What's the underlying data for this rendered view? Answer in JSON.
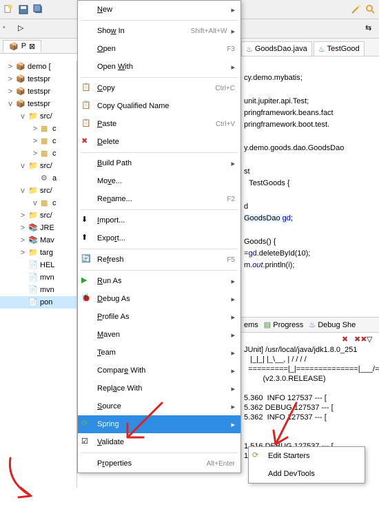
{
  "toolbar_top": {
    "items": [
      "new",
      "save",
      "open",
      "print"
    ]
  },
  "tabs_left": {
    "p": "P"
  },
  "editor_tabs": [
    {
      "icon": "java",
      "label": "GoodsDao.java"
    },
    {
      "icon": "java",
      "label": "TestGood"
    }
  ],
  "tree": [
    {
      "l": 1,
      "exp": ">",
      "icon": "pkg",
      "label": "demo ["
    },
    {
      "l": 1,
      "exp": ">",
      "icon": "pkg",
      "label": "testspr"
    },
    {
      "l": 1,
      "exp": ">",
      "icon": "pkg",
      "label": "testspr"
    },
    {
      "l": 1,
      "exp": "v",
      "icon": "pkg",
      "label": "testspr"
    },
    {
      "l": 2,
      "exp": "v",
      "icon": "srcfolder",
      "label": "src/"
    },
    {
      "l": 3,
      "exp": ">",
      "icon": "package",
      "label": "c"
    },
    {
      "l": 3,
      "exp": ">",
      "icon": "package",
      "label": "c"
    },
    {
      "l": 3,
      "exp": ">",
      "icon": "package",
      "label": "c"
    },
    {
      "l": 2,
      "exp": "v",
      "icon": "srcfolder",
      "label": "src/"
    },
    {
      "l": 3,
      "exp": "",
      "icon": "app",
      "label": "a"
    },
    {
      "l": 2,
      "exp": "v",
      "icon": "srcfolder",
      "label": "src/"
    },
    {
      "l": 3,
      "exp": "v",
      "icon": "package",
      "label": "c"
    },
    {
      "l": 2,
      "exp": ">",
      "icon": "srcfolder",
      "label": "src/"
    },
    {
      "l": 2,
      "exp": ">",
      "icon": "lib",
      "label": "JRE"
    },
    {
      "l": 2,
      "exp": ">",
      "icon": "lib",
      "label": "Mav"
    },
    {
      "l": 2,
      "exp": ">",
      "icon": "folder",
      "label": "targ"
    },
    {
      "l": 2,
      "exp": "",
      "icon": "file",
      "label": "HEL"
    },
    {
      "l": 2,
      "exp": "",
      "icon": "file",
      "label": "mvn"
    },
    {
      "l": 2,
      "exp": "",
      "icon": "file",
      "label": "mvn"
    },
    {
      "l": 2,
      "exp": "",
      "icon": "xml",
      "label": "pon",
      "sel": true
    }
  ],
  "ctx": [
    {
      "t": "mi",
      "icon": "",
      "label": "New",
      "sc": "",
      "sub": true,
      "u": 0
    },
    {
      "t": "sep"
    },
    {
      "t": "mi",
      "icon": "",
      "label": "Show In",
      "sc": "Shift+Alt+W",
      "sub": true,
      "u": 3
    },
    {
      "t": "mi",
      "icon": "",
      "label": "Open",
      "sc": "F3",
      "u": 0
    },
    {
      "t": "mi",
      "icon": "",
      "label": "Open With",
      "sc": "",
      "sub": true,
      "u": 5
    },
    {
      "t": "sep"
    },
    {
      "t": "mi",
      "icon": "copy",
      "label": "Copy",
      "sc": "Ctrl+C",
      "u": 0
    },
    {
      "t": "mi",
      "icon": "copyq",
      "label": "Copy Qualified Name",
      "sc": ""
    },
    {
      "t": "mi",
      "icon": "paste",
      "label": "Paste",
      "sc": "Ctrl+V",
      "u": 0
    },
    {
      "t": "mi",
      "icon": "delete",
      "label": "Delete",
      "sc": "",
      "u": 0
    },
    {
      "t": "sep"
    },
    {
      "t": "mi",
      "icon": "",
      "label": "Build Path",
      "sc": "",
      "sub": true,
      "u": 0
    },
    {
      "t": "mi",
      "icon": "",
      "label": "Move...",
      "sc": "",
      "u": 2
    },
    {
      "t": "mi",
      "icon": "",
      "label": "Rename...",
      "sc": "F2",
      "u": 2
    },
    {
      "t": "sep"
    },
    {
      "t": "mi",
      "icon": "import",
      "label": "Import...",
      "sc": "",
      "u": 0
    },
    {
      "t": "mi",
      "icon": "export",
      "label": "Export...",
      "sc": "",
      "u": 4
    },
    {
      "t": "sep"
    },
    {
      "t": "mi",
      "icon": "refresh",
      "label": "Refresh",
      "sc": "F5",
      "u": 2
    },
    {
      "t": "sep"
    },
    {
      "t": "mi",
      "icon": "run",
      "label": "Run As",
      "sc": "",
      "sub": true,
      "u": 0
    },
    {
      "t": "mi",
      "icon": "debug",
      "label": "Debug As",
      "sc": "",
      "sub": true,
      "u": 0
    },
    {
      "t": "mi",
      "icon": "",
      "label": "Profile As",
      "sc": "",
      "sub": true,
      "u": 0
    },
    {
      "t": "mi",
      "icon": "",
      "label": "Maven",
      "sc": "",
      "sub": true,
      "u": 0
    },
    {
      "t": "mi",
      "icon": "",
      "label": "Team",
      "sc": "",
      "sub": true,
      "u": 0
    },
    {
      "t": "mi",
      "icon": "",
      "label": "Compare With",
      "sc": "",
      "sub": true,
      "u": 6
    },
    {
      "t": "mi",
      "icon": "",
      "label": "Replace With",
      "sc": "",
      "sub": true,
      "u": 4
    },
    {
      "t": "mi",
      "icon": "",
      "label": "Source",
      "sc": "",
      "sub": true,
      "u": 0
    },
    {
      "t": "mi",
      "icon": "spring",
      "label": "Spring",
      "sc": "",
      "sub": true,
      "sel": true
    },
    {
      "t": "mi",
      "icon": "check",
      "label": "Validate",
      "sc": "",
      "u": 0
    },
    {
      "t": "sep"
    },
    {
      "t": "mi",
      "icon": "",
      "label": "Properties",
      "sc": "Alt+Enter",
      "u": 1
    }
  ],
  "submenu": [
    {
      "icon": "spring",
      "label": "Edit Starters"
    },
    {
      "icon": "",
      "label": "Add DevTools"
    }
  ],
  "code": {
    "l1": "cy.demo.mybatis;",
    "l2": "",
    "l3": "unit.jupiter.api.Test;",
    "l4": "pringframework.beans.fact",
    "l5": "pringframework.boot.test.",
    "l6": "",
    "l7": "y.demo.goods.dao.GoodsDao",
    "l8": "",
    "l9": "st",
    "l10": "TestGoods {",
    "l11": "",
    "l12": "d",
    "l13a": "GoodsDao ",
    "l13b": "gd",
    "l13c": ";",
    "l14": "",
    "l15": "Goods() {",
    "l16a": "=",
    "l16b": "gd",
    "l16c": ".deleteById(10);",
    "l17a": "m.",
    "l17b": "out",
    "l17c": ".println(",
    "l17d": "i",
    "l17e": ");"
  },
  "bottom_tabs": {
    "t1": "ems",
    "t2": "Progress",
    "t3": "Debug She"
  },
  "console": {
    "l1": "JUnit] /usr/local/java/jdk1.8.0_251",
    "l2": "   |_|_| |_\\__, | / / / /",
    "l3": "  =========|_|==============|___/=/_/_/_/",
    "l4": "         (v2.3.0.RELEASE)",
    "l5": "",
    "l6": "5.360  INFO 127537 --- [",
    "l7": "5.362 DEBUG 127537 --- [",
    "l8": "5.362  INFO 127537 --- [",
    "l9": "",
    "l10": "",
    "l11": "1.516 DEBUG 127537 --- [",
    "l12": "1.644  INFO 127537 --- ["
  }
}
